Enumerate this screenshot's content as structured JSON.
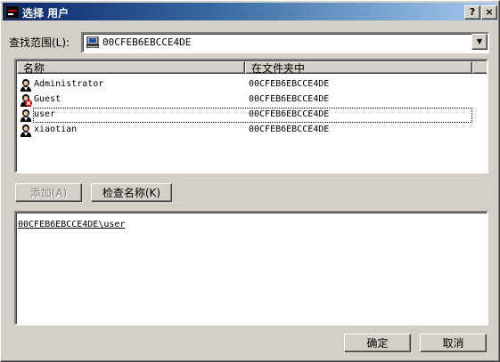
{
  "window": {
    "title": "选择 用户",
    "help_label": "?",
    "close_label": "×"
  },
  "look_in": {
    "label": "查找范围(L):",
    "value": "00CFEB6EBCCE4DE",
    "arrow": "▼"
  },
  "list": {
    "columns": {
      "name": "名称",
      "folder": "在文件夹中"
    },
    "rows": [
      {
        "name": "Administrator",
        "folder": "00CFEB6EBCCE4DE",
        "icon": "user-icon"
      },
      {
        "name": "Guest",
        "folder": "00CFEB6EBCCE4DE",
        "icon": "disabled-user-icon"
      },
      {
        "name": "user",
        "folder": "00CFEB6EBCCE4DE",
        "icon": "user-icon"
      },
      {
        "name": "xiaotian",
        "folder": "00CFEB6EBCCE4DE",
        "icon": "user-icon"
      }
    ]
  },
  "buttons": {
    "add": "添加(A)",
    "check_names": "检查名称(K)",
    "ok": "确定",
    "cancel": "取消"
  },
  "selected_names": "00CFEB6EBCCE4DE\\user"
}
